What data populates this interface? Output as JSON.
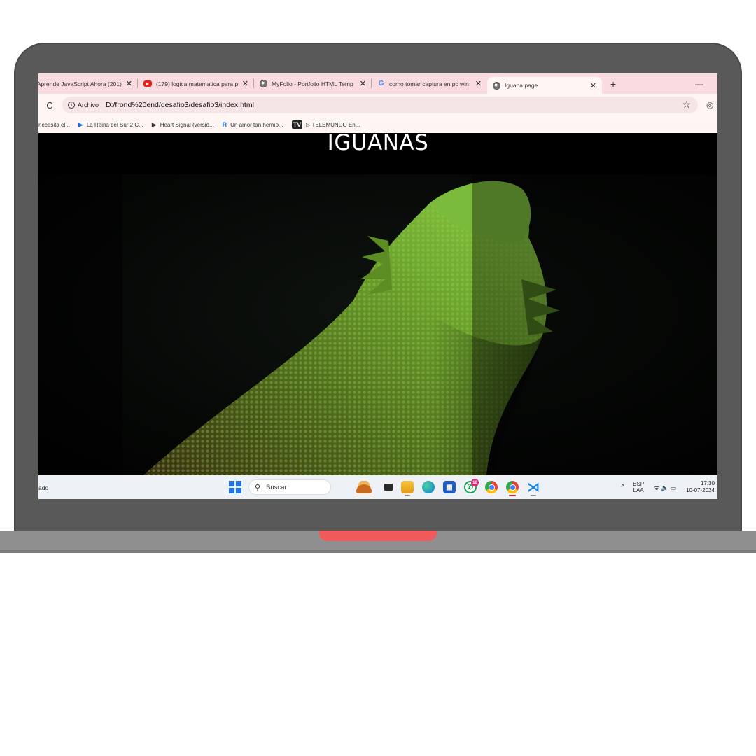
{
  "browser": {
    "tabs": [
      {
        "title": "(201) Aprende JavaScript Ahora",
        "icon": "youtube-icon"
      },
      {
        "title": "(179) logica matematica para p",
        "icon": "youtube-icon"
      },
      {
        "title": "MyFolio - Portfolio HTML Temp",
        "icon": "globe-icon"
      },
      {
        "title": "como tomar captura en pc win",
        "icon": "google-icon"
      },
      {
        "title": "Iguana page",
        "icon": "globe-icon",
        "active": true
      }
    ],
    "new_tab": "+",
    "close": "✕",
    "minimize": "—",
    "reload": "C",
    "chip": "Archivo",
    "url": "D:/frond%20end/desafio3/desafio3/index.html",
    "bookmarks": [
      {
        "label": "necesita el..."
      },
      {
        "label": "La Reina del Sur 2 C..."
      },
      {
        "label": "Heart Signal (versió..."
      },
      {
        "label": "Un amor tan hermo..."
      },
      {
        "label": "▷ TELEMUNDO En..."
      }
    ]
  },
  "page": {
    "heading": "IGUANAS"
  },
  "taskbar": {
    "left_text": "ado",
    "search_placeholder": "Buscar",
    "whatsapp_badge": "16",
    "lang_top": "ESP",
    "lang_bottom": "LAA",
    "time": "17:30",
    "date": "10-07-2024"
  },
  "colors": {
    "laptop_body": "#595959",
    "laptop_base": "#8f8f8f",
    "laptop_notch": "#f05a5a",
    "tab_strip": "#fadbe0",
    "page_background": "#000000"
  }
}
